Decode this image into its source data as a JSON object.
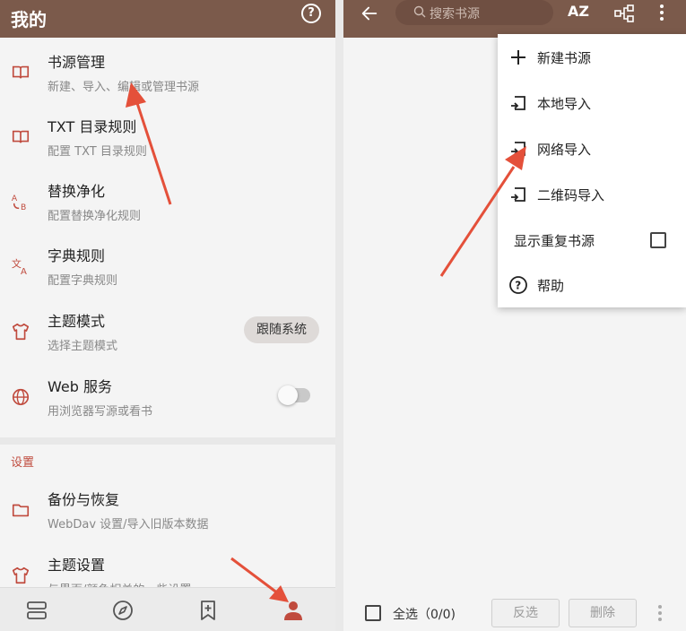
{
  "left": {
    "title": "我的",
    "items": [
      {
        "title": "书源管理",
        "subtitle": "新建、导入、编辑或管理书源",
        "icon": "book-icon"
      },
      {
        "title": "TXT 目录规则",
        "subtitle": "配置 TXT 目录规则",
        "icon": "book-icon"
      },
      {
        "title": "替换净化",
        "subtitle": "配置替换净化规则",
        "icon": "replace-icon"
      },
      {
        "title": "字典规则",
        "subtitle": "配置字典规则",
        "icon": "translate-icon"
      },
      {
        "title": "主题模式",
        "subtitle": "选择主题模式",
        "icon": "shirt-icon"
      },
      {
        "title": "Web 服务",
        "subtitle": "用浏览器写源或看书",
        "icon": "globe-icon"
      }
    ],
    "theme_mode_value": "跟随系统",
    "web_service_enabled": false,
    "section_label": "设置",
    "settings_items": [
      {
        "title": "备份与恢复",
        "subtitle": "WebDav 设置/导入旧版本数据",
        "icon": "folder-icon"
      },
      {
        "title": "主题设置",
        "subtitle": "与界面/颜色相关的一些设置",
        "icon": "shirt-icon"
      }
    ]
  },
  "right": {
    "search_placeholder": "搜索书源",
    "sort_label": "AZ",
    "menu": [
      {
        "label": "新建书源",
        "icon": "plus-icon"
      },
      {
        "label": "本地导入",
        "icon": "import-icon"
      },
      {
        "label": "网络导入",
        "icon": "import-icon"
      },
      {
        "label": "二维码导入",
        "icon": "import-icon"
      },
      {
        "label": "显示重复书源",
        "icon": "",
        "checked": false
      },
      {
        "label": "帮助",
        "icon": "help-icon"
      }
    ],
    "bottom": {
      "select_all": "全选（0/0)",
      "invert": "反选",
      "delete": "删除"
    }
  },
  "colors": {
    "brand": "#7b5a4b",
    "accent": "#c04b3e",
    "arrow": "#e4503a"
  }
}
